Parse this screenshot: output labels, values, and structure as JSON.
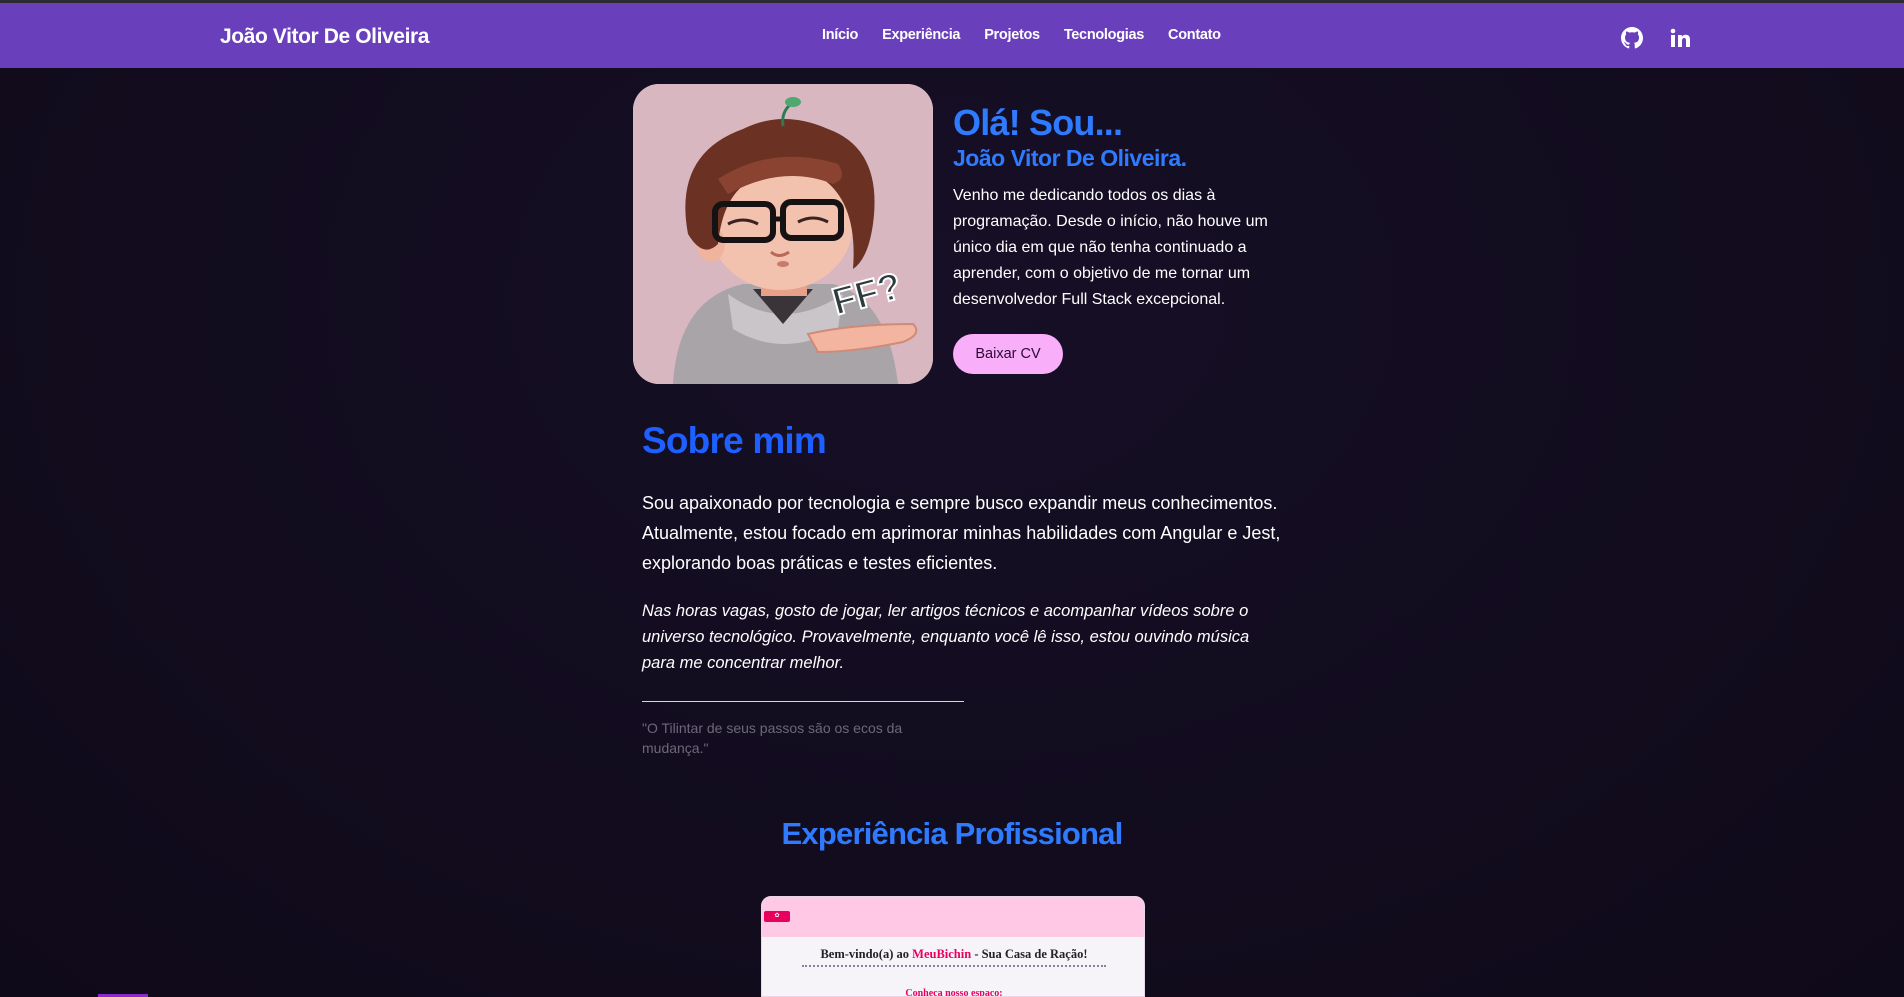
{
  "nav": {
    "brand": "João Vitor De Oliveira",
    "links": [
      "Início",
      "Experiência",
      "Projetos",
      "Tecnologias",
      "Contato"
    ],
    "social": [
      "github-icon",
      "linkedin-icon"
    ],
    "background": "#6a3fbc"
  },
  "hero": {
    "greeting": "Olá! Sou...",
    "name": "João Vitor De Oliveira.",
    "description": "Venho me dedicando todos os dias à programação. Desde o início, não houve um único dia em que não tenha continuado a aprender, com o objetivo de me tornar um desenvolvedor Full Stack excepcional.",
    "cv_button": "Baixar CV",
    "accent": "#2f7bff",
    "button_color": "#f8aef8"
  },
  "about": {
    "title": "Sobre mim",
    "paragraph1": "Sou apaixonado por tecnologia e sempre busco expandir meus conhecimentos. Atualmente, estou focado em aprimorar minhas habilidades com Angular e Jest, explorando boas práticas e testes eficientes.",
    "paragraph2": "Nas horas vagas, gosto de jogar, ler artigos técnicos e acompanhar vídeos sobre o universo tecnológico. Provavelmente, enquanto você lê isso, estou ouvindo música para me concentrar melhor.",
    "quote": "\"O Tilintar de seus passos são os ecos da mudança.\""
  },
  "experience": {
    "title": "Experiência Profissional",
    "preview": {
      "title_prefix": "Bem-vindo(a) ao ",
      "title_highlight": "MeuBichin",
      "title_suffix": " - Sua Casa de Ração!",
      "link": "Conheça nosso espaço:"
    }
  }
}
